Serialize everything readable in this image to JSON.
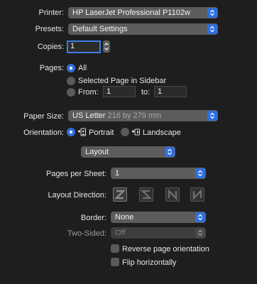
{
  "printer": {
    "label": "Printer:",
    "value": "HP LaserJet Professional P1102w"
  },
  "presets": {
    "label": "Presets:",
    "value": "Default Settings"
  },
  "copies": {
    "label": "Copies:",
    "value": "1"
  },
  "pages": {
    "label": "Pages:",
    "all": "All",
    "selected": "Selected Page in Sidebar",
    "from_label": "From:",
    "from_value": "1",
    "to_label": "to:",
    "to_value": "1"
  },
  "paper_size": {
    "label": "Paper Size:",
    "value": "US Letter",
    "dims": "216 by 279 mm"
  },
  "orientation": {
    "label": "Orientation:",
    "portrait": "Portrait",
    "landscape": "Landscape"
  },
  "section": {
    "value": "Layout"
  },
  "pages_per_sheet": {
    "label": "Pages per Sheet:",
    "value": "1"
  },
  "layout_direction": {
    "label": "Layout Direction:"
  },
  "border": {
    "label": "Border:",
    "value": "None"
  },
  "two_sided": {
    "label": "Two-Sided:",
    "value": "Off"
  },
  "reverse": {
    "label": "Reverse page orientation"
  },
  "flip": {
    "label": "Flip horizontally"
  },
  "colors": {
    "accent": "#2f6fdf",
    "background": "#1e1e1e",
    "control": "#5c5c5e"
  }
}
